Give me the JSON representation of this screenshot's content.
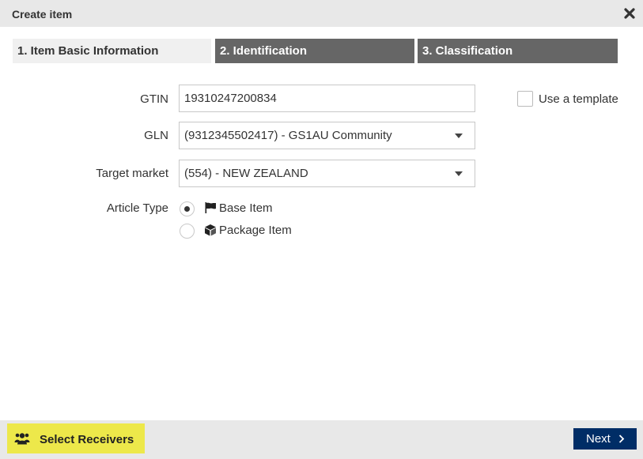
{
  "dialog": {
    "title": "Create item"
  },
  "steps": [
    {
      "label": "1. Item Basic Information"
    },
    {
      "label": "2. Identification"
    },
    {
      "label": "3. Classification"
    }
  ],
  "form": {
    "gtin": {
      "label": "GTIN",
      "value": "19310247200834"
    },
    "gln": {
      "label": "GLN",
      "value": "(9312345502417) - GS1AU Community"
    },
    "target_market": {
      "label": "Target market",
      "value": "(554) - NEW ZEALAND"
    },
    "template": {
      "label": "Use a template",
      "checked": false
    },
    "article_type": {
      "label": "Article Type",
      "options": [
        {
          "label": "Base Item",
          "icon": "flag-icon",
          "selected": true
        },
        {
          "label": "Package Item",
          "icon": "package-icon",
          "selected": false
        }
      ]
    }
  },
  "footer": {
    "select_receivers_label": "Select Receivers",
    "next_label": "Next"
  },
  "colors": {
    "tab_inactive": "#666666",
    "receivers_button": "#ede84a",
    "next_button": "#002d66"
  }
}
